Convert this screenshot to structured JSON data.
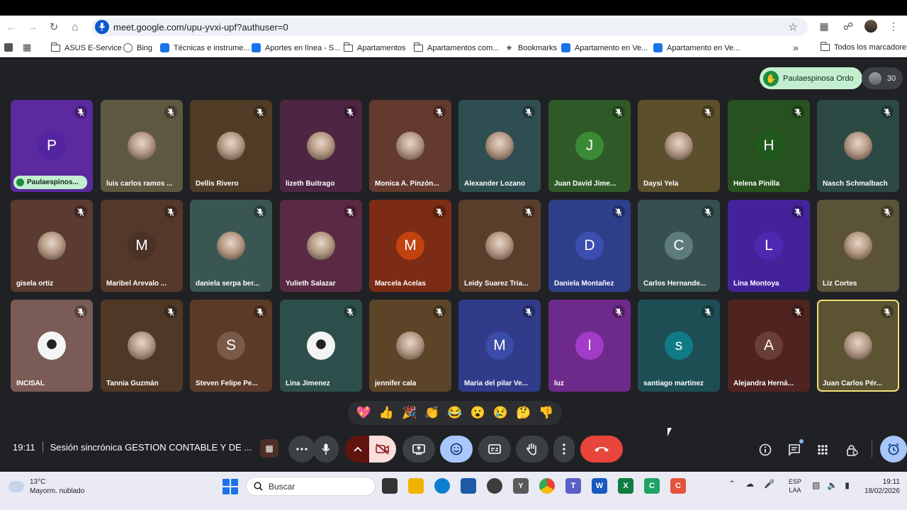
{
  "browser": {
    "url": "meet.google.com/upu-yvxi-upf?authuser=0",
    "bookmarks": [
      {
        "label": "ASUS E-Service",
        "icon": "folder-icon"
      },
      {
        "label": "Bing",
        "icon": "globe-icon"
      },
      {
        "label": "Técnicas e instrume...",
        "icon": "site-icon"
      },
      {
        "label": "Aportes en línea - S...",
        "icon": "site-icon"
      },
      {
        "label": "Apartamentos",
        "icon": "folder-icon"
      },
      {
        "label": "Apartamentos com...",
        "icon": "folder-icon"
      },
      {
        "label": "Bookmarks",
        "icon": "star-icon"
      },
      {
        "label": "Apartamento en Ve...",
        "icon": "site-icon"
      },
      {
        "label": "Apartamento en Ve...",
        "icon": "site-icon"
      }
    ],
    "more_bookmarks": "»",
    "all_bookmarks": "Todos los marcadores"
  },
  "meet": {
    "raised_hand_name": "Paulaespinosa Ordo",
    "participant_count": "30",
    "participants": [
      {
        "name": "Paulaespinos...",
        "initial": "P",
        "bg": "#5b2a9e",
        "avatar_color": "#5325a0",
        "presenter_pill": true
      },
      {
        "name": "luis carlos ramos ...",
        "initial": "",
        "bg": "#5e5841",
        "photo": true
      },
      {
        "name": "Dellis Rivero",
        "initial": "",
        "bg": "#4f3b26",
        "photo": true
      },
      {
        "name": "lizeth Buitrago",
        "initial": "",
        "bg": "#4e2543",
        "photo": true
      },
      {
        "name": "Monica A. Pinzón...",
        "initial": "",
        "bg": "#643a2e",
        "photo": true
      },
      {
        "name": "Alexander Lozano",
        "initial": "",
        "bg": "#2f4e51",
        "photo": true
      },
      {
        "name": "Juan David Jime...",
        "initial": "J",
        "bg": "#2f5a28",
        "avatar_color": "#3b8a36"
      },
      {
        "name": "Daysi Yela",
        "initial": "",
        "bg": "#5c4f2c",
        "photo": true
      },
      {
        "name": "Helena Pinilla",
        "initial": "H",
        "bg": "#27521f",
        "avatar_color": "#1f5a1c"
      },
      {
        "name": "Nasch Schmalbach",
        "initial": "",
        "bg": "#2c4a43",
        "photo": true
      },
      {
        "name": "gisela ortiz",
        "initial": "",
        "bg": "#5a3a31",
        "photo": true
      },
      {
        "name": "Maribel Arevalo ...",
        "initial": "M",
        "bg": "#553829",
        "avatar_color": "#4a3226"
      },
      {
        "name": "daniela serpa ber...",
        "initial": "",
        "bg": "#3a5653",
        "photo": true
      },
      {
        "name": "Yulieth Salazar",
        "initial": "",
        "bg": "#5a2a44",
        "photo": true
      },
      {
        "name": "Marcela Acelas",
        "initial": "M",
        "bg": "#7c2c14",
        "avatar_color": "#c1420f"
      },
      {
        "name": "Leidy Suarez Tria...",
        "initial": "",
        "bg": "#5a3e2c",
        "photo": true
      },
      {
        "name": "Daniela Montañez",
        "initial": "D",
        "bg": "#2e3f8a",
        "avatar_color": "#3c4fb0"
      },
      {
        "name": "Carlos Hernande...",
        "initial": "C",
        "bg": "#36504f",
        "avatar_color": "#5d7b7a"
      },
      {
        "name": "Lina Montoya",
        "initial": "L",
        "bg": "#44239a",
        "avatar_color": "#4d28b0"
      },
      {
        "name": "Liz Cortes",
        "initial": "",
        "bg": "#5b5338",
        "photo": true
      },
      {
        "name": "INCISAL",
        "initial": "",
        "bg": "#7a5b55",
        "photo": true,
        "avatar_color": "#f4f4f4"
      },
      {
        "name": "Tannia Guzmán",
        "initial": "",
        "bg": "#4f3826",
        "photo": true
      },
      {
        "name": "Steven Felipe Pe...",
        "initial": "S",
        "bg": "#5b3a28",
        "avatar_color": "#7a5b48"
      },
      {
        "name": "Lina Jimenez",
        "initial": "",
        "bg": "#2d4f4b",
        "photo": true,
        "avatar_color": "#f4f4f4"
      },
      {
        "name": "jennifer cala",
        "initial": "",
        "bg": "#5c4428",
        "photo": true
      },
      {
        "name": "Maria del pilar Ve...",
        "initial": "M",
        "bg": "#303b8a",
        "avatar_color": "#3a4ba8"
      },
      {
        "name": "luz",
        "initial": "I",
        "bg": "#6e2a8a",
        "avatar_color": "#a23bc7"
      },
      {
        "name": "santiago martinez",
        "initial": "s",
        "bg": "#1d4e54",
        "avatar_color": "#0f7b86"
      },
      {
        "name": "Alejandra Herná...",
        "initial": "A",
        "bg": "#4f2420",
        "avatar_color": "#6a3d37"
      },
      {
        "name": "Juan Carlos Pér...",
        "initial": "",
        "bg": "#5b5331",
        "photo": true,
        "active_speaker": true
      }
    ],
    "reactions": [
      "💖",
      "👍",
      "🎉",
      "👏",
      "😂",
      "😮",
      "😢",
      "🤔",
      "👎"
    ],
    "time": "19:11",
    "meeting_title": "Sesión sincrónica GESTION CONTABLE Y DE ..."
  },
  "taskbar": {
    "temperature": "13°C",
    "weather": "Mayorm. nublado",
    "search_placeholder": "Buscar",
    "lang_top": "ESP",
    "lang_bottom": "LAA",
    "clock_time": "19:11",
    "clock_date": "18/02/2026"
  },
  "colors": {
    "meet_bg": "#202124",
    "end_call": "#e8453c",
    "raise_hand_pill": "#c4eed0",
    "active_speaker_border": "#f2e07a"
  }
}
